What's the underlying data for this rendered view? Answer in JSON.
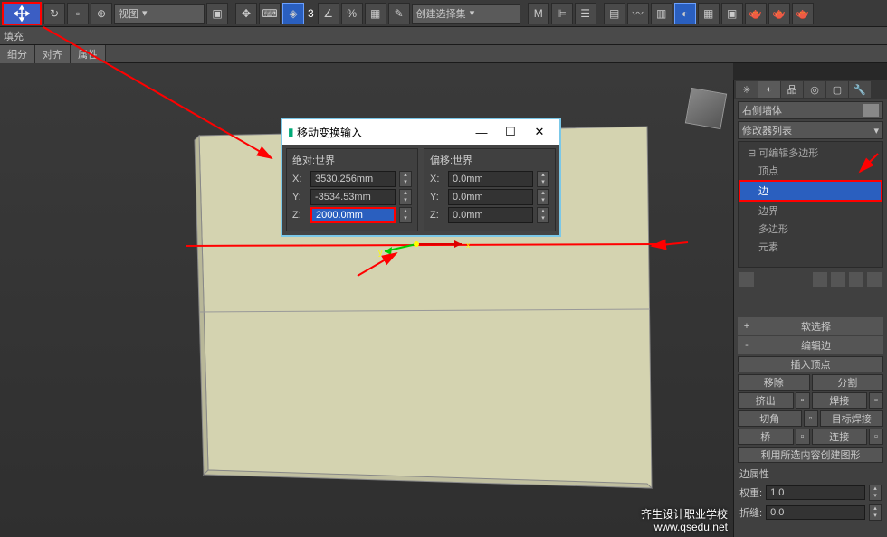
{
  "toolbar": {
    "view_dropdown": "视图",
    "selection_set_dropdown": "创建选择集",
    "num3": "3"
  },
  "secbar": {
    "label": "填充"
  },
  "tabs": [
    "细分",
    "对齐",
    "属性"
  ],
  "dialog": {
    "title": "移动变换输入",
    "group_abs": "绝对:世界",
    "group_off": "偏移:世界",
    "labels": {
      "x": "X:",
      "y": "Y:",
      "z": "Z:"
    },
    "abs": {
      "x": "3530.256mm",
      "y": "-3534.53mm",
      "z": "2000.0mm"
    },
    "off": {
      "x": "0.0mm",
      "y": "0.0mm",
      "z": "0.0mm"
    }
  },
  "rpanel": {
    "object_name": "右侧墙体",
    "modifier_list": "修改器列表",
    "tree": {
      "root": "可编辑多边形",
      "items": [
        "顶点",
        "边",
        "边界",
        "多边形",
        "元素"
      ]
    },
    "sections": {
      "soft_sel": "软选择",
      "edit_edge": "编辑边",
      "insert_vertex": "插入顶点",
      "remove": "移除",
      "split": "分割",
      "extrude": "挤出",
      "weld": "焊接",
      "chamfer": "切角",
      "target_weld": "目标焊接",
      "bridge": "桥",
      "connect": "连接",
      "create_shape": "利用所选内容创建图形",
      "edge_props": "边属性",
      "weight": "权重:",
      "weight_val": "1.0",
      "crease": "折缝:",
      "crease_val": "0.0"
    }
  },
  "watermark": {
    "line1": "齐生设计职业学校",
    "line2": "www.qsedu.net"
  }
}
